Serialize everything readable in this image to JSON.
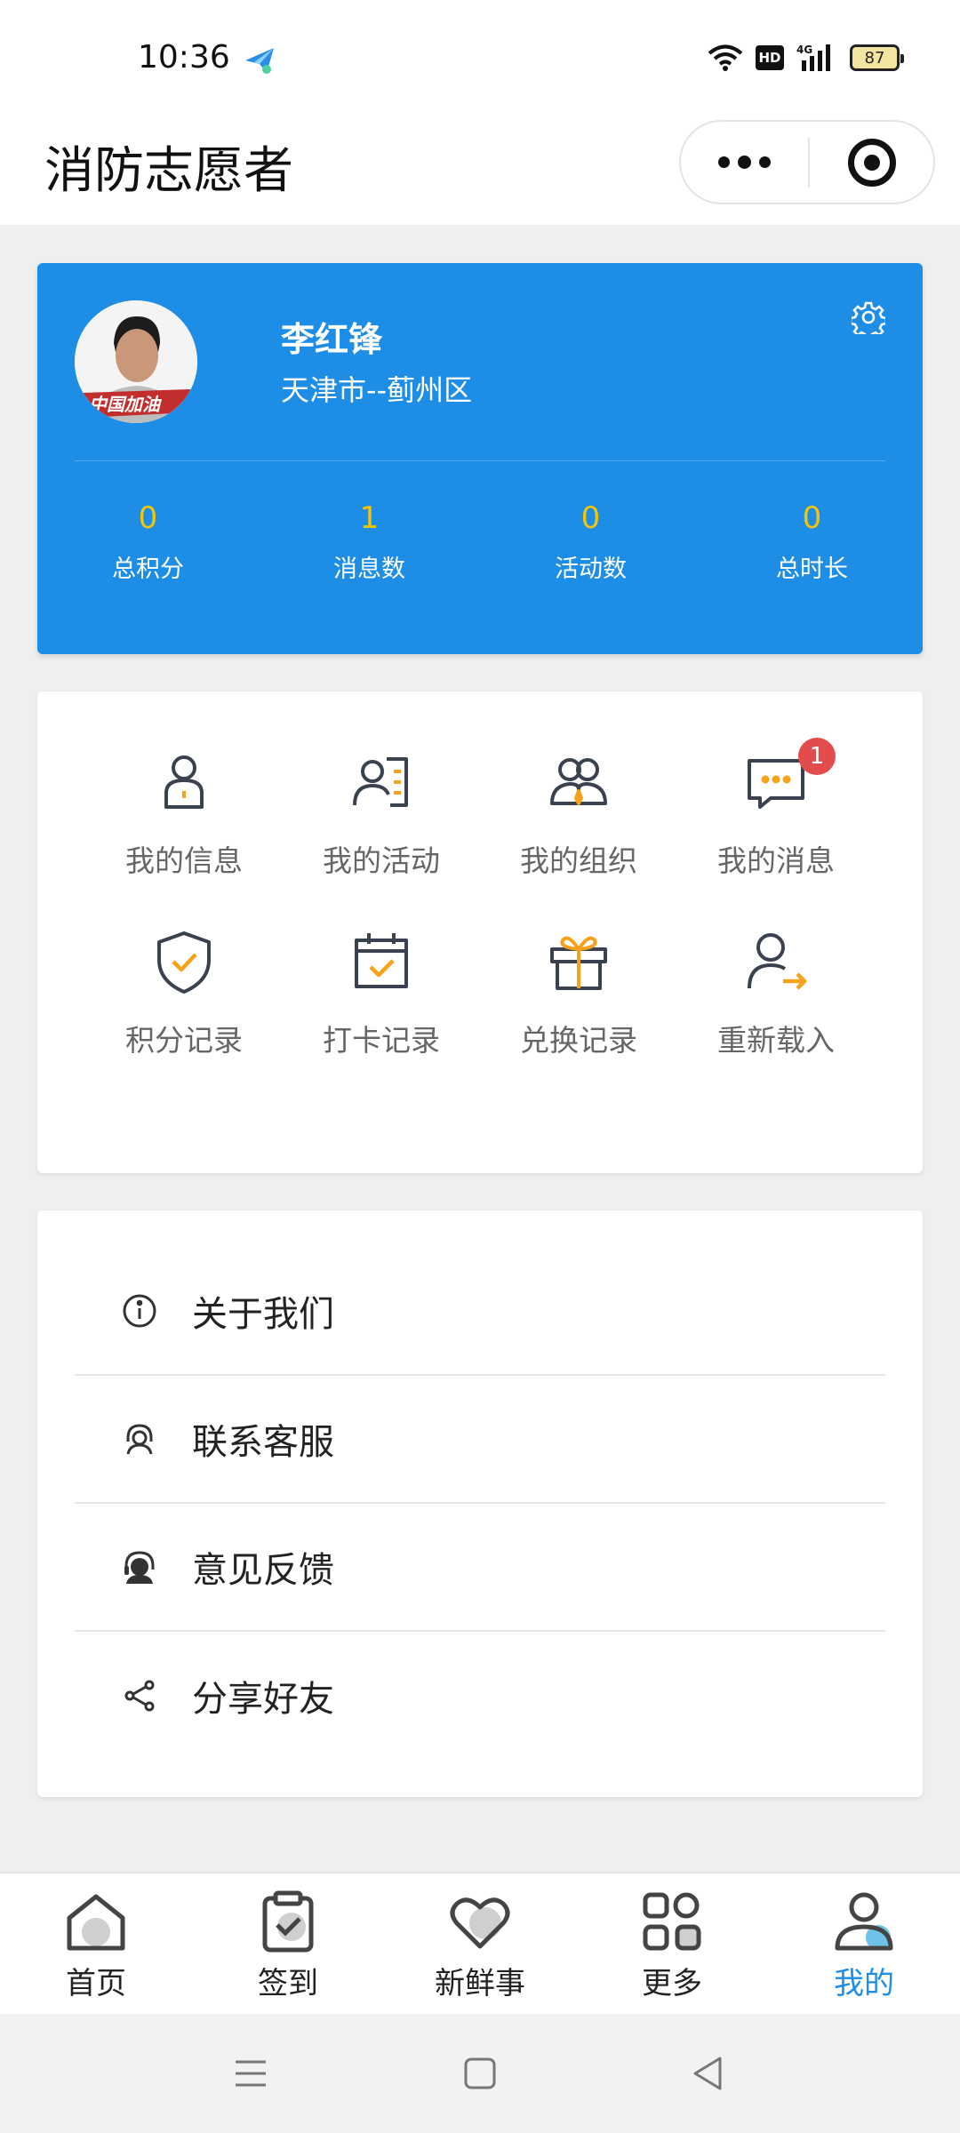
{
  "status_bar": {
    "time": "10:36",
    "hd": "HD",
    "network": "4G",
    "battery": "87"
  },
  "header": {
    "title": "消防志愿者"
  },
  "profile": {
    "name": "李红锋",
    "region": "天津市--蓟州区",
    "avatar_caption": "中国加油",
    "stats": [
      {
        "value": "0",
        "label": "总积分"
      },
      {
        "value": "1",
        "label": "消息数"
      },
      {
        "value": "0",
        "label": "活动数"
      },
      {
        "value": "0",
        "label": "总时长"
      }
    ]
  },
  "grid": {
    "items": [
      {
        "label": "我的信息",
        "icon": "user-info-icon"
      },
      {
        "label": "我的活动",
        "icon": "user-list-icon"
      },
      {
        "label": "我的组织",
        "icon": "group-icon"
      },
      {
        "label": "我的消息",
        "icon": "message-icon",
        "badge": "1"
      },
      {
        "label": "积分记录",
        "icon": "shield-check-icon"
      },
      {
        "label": "打卡记录",
        "icon": "calendar-check-icon"
      },
      {
        "label": "兑换记录",
        "icon": "gift-icon"
      },
      {
        "label": "重新载入",
        "icon": "user-arrow-icon"
      }
    ]
  },
  "menu": {
    "items": [
      {
        "label": "关于我们",
        "icon": "info-icon"
      },
      {
        "label": "联系客服",
        "icon": "support-icon"
      },
      {
        "label": "意见反馈",
        "icon": "feedback-icon"
      },
      {
        "label": "分享好友",
        "icon": "share-icon"
      }
    ]
  },
  "tabbar": {
    "items": [
      {
        "label": "首页",
        "icon": "home-icon"
      },
      {
        "label": "签到",
        "icon": "clipboard-check-icon"
      },
      {
        "label": "新鲜事",
        "icon": "heart-icon"
      },
      {
        "label": "更多",
        "icon": "apps-icon"
      },
      {
        "label": "我的",
        "icon": "profile-icon",
        "active": true
      }
    ]
  },
  "colors": {
    "primary": "#1e8de6",
    "accent": "#f7a21b",
    "stat_value": "#f7c500",
    "badge": "#e34c4c"
  }
}
